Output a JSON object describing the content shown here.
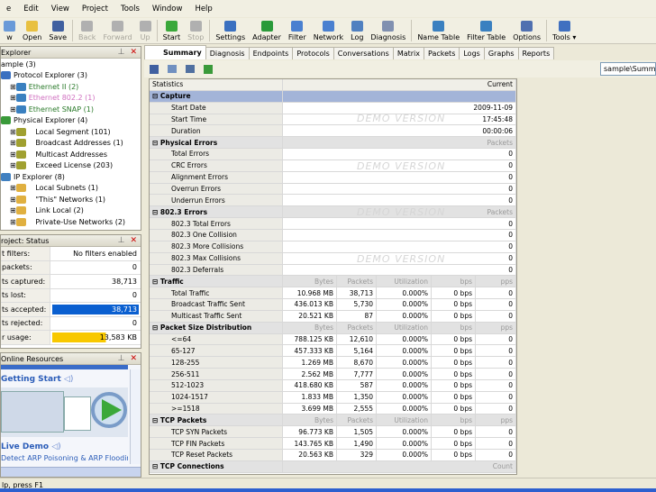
{
  "menu": [
    "e",
    "Edit",
    "View",
    "Project",
    "Tools",
    "Window",
    "Help"
  ],
  "toolbar": [
    {
      "label": "w",
      "color": "#6a9ad8"
    },
    {
      "label": "Open",
      "color": "#e8c040"
    },
    {
      "label": "Save",
      "color": "#4060a0"
    },
    {
      "sep": true
    },
    {
      "label": "Back",
      "color": "#b0b0b0",
      "disabled": true
    },
    {
      "label": "Forward",
      "color": "#b0b0b0",
      "disabled": true
    },
    {
      "label": "Up",
      "color": "#b0b0b0",
      "disabled": true
    },
    {
      "sep": true
    },
    {
      "label": "Start",
      "color": "#3aa83a"
    },
    {
      "label": "Stop",
      "color": "#b0b0b0",
      "disabled": true
    },
    {
      "sep": true
    },
    {
      "label": "Settings",
      "color": "#3a70c0"
    },
    {
      "label": "Adapter",
      "color": "#2a9a3a"
    },
    {
      "label": "Filter",
      "color": "#4a80d0"
    },
    {
      "label": "Network",
      "color": "#4a80d0"
    },
    {
      "label": "Log",
      "color": "#5080c0"
    },
    {
      "label": "Diagnosis",
      "color": "#8090b0"
    },
    {
      "sep": true
    },
    {
      "label": "Name Table",
      "color": "#3a80c0"
    },
    {
      "label": "Filter Table",
      "color": "#3a80c0"
    },
    {
      "label": "Options",
      "color": "#5070b0"
    },
    {
      "sep": true
    },
    {
      "label": "Tools ▾",
      "color": "#4070c0"
    }
  ],
  "explorer": {
    "title": "Explorer",
    "items": [
      {
        "label": "ample (3)",
        "indent": 0,
        "color": "#000",
        "icon": "none"
      },
      {
        "label": "Protocol Explorer (3)",
        "indent": 0,
        "color": "#000",
        "icon": "#3a70c0"
      },
      {
        "label": "Ethernet II (2)",
        "indent": 1,
        "color": "#2a7a2a",
        "icon": "#3a80c0"
      },
      {
        "label": "Ethernet 802.2 (1)",
        "indent": 1,
        "color": "#d070c0",
        "icon": "#3a80c0"
      },
      {
        "label": "Ethernet SNAP (1)",
        "indent": 1,
        "color": "#2a7a2a",
        "icon": "#3a80c0"
      },
      {
        "label": "Physical Explorer (4)",
        "indent": 0,
        "color": "#000",
        "icon": "#3a9a3a"
      },
      {
        "label": "Local Segment (101)",
        "indent": 2,
        "color": "#000",
        "icon": "#a0a030"
      },
      {
        "label": "Broadcast Addresses (1)",
        "indent": 2,
        "color": "#000",
        "icon": "#a0a030"
      },
      {
        "label": "Multicast Addresses",
        "indent": 2,
        "color": "#000",
        "icon": "#a0a030"
      },
      {
        "label": "Exceed License (203)",
        "indent": 2,
        "color": "#000",
        "icon": "#a0a030"
      },
      {
        "label": "IP Explorer (8)",
        "indent": 0,
        "color": "#000",
        "icon": "#4080c0"
      },
      {
        "label": "Local Subnets (1)",
        "indent": 2,
        "color": "#000",
        "icon": "#e0b040"
      },
      {
        "label": "\"This\" Networks (1)",
        "indent": 2,
        "color": "#000",
        "icon": "#e0b040"
      },
      {
        "label": "Link Local (2)",
        "indent": 2,
        "color": "#000",
        "icon": "#e0b040"
      },
      {
        "label": "Private-Use Networks (2)",
        "indent": 2,
        "color": "#000",
        "icon": "#e0b040"
      }
    ]
  },
  "status": {
    "title": "roject: Status",
    "rows": [
      {
        "label": "t filters:",
        "value": "No filters enabled"
      },
      {
        "label": "packets:",
        "value": "0"
      },
      {
        "label": "ts captured:",
        "value": "38,713"
      },
      {
        "label": "ts lost:",
        "value": "0"
      },
      {
        "label": "ts accepted:",
        "value": "38,713",
        "bar": "#0a5fd0",
        "fill": 1.0
      },
      {
        "label": "ts rejected:",
        "value": "0"
      },
      {
        "label": "r usage:",
        "value": "13,583 KB",
        "bar": "#f8c800",
        "fill": 0.62
      }
    ]
  },
  "online": {
    "title": "Online Resources",
    "getting_started": "Getting Start",
    "live_demo": "Live Demo",
    "link": "Detect ARP Poisoning & ARP Flooding"
  },
  "tabs": [
    "Summary",
    "Diagnosis",
    "Endpoints",
    "Protocols",
    "Conversations",
    "Matrix",
    "Packets",
    "Logs",
    "Graphs",
    "Reports"
  ],
  "path": "sample\\Summary",
  "watermark": "DEMO VERSION",
  "grid": {
    "headers": [
      "Statistics",
      "Current"
    ],
    "sections": [
      {
        "title": "Capture",
        "blue": true,
        "cols": [],
        "rows": [
          [
            "Start Date",
            "2009-11-09"
          ],
          [
            "Start Time",
            "17:45:48"
          ],
          [
            "Duration",
            "00:00:06"
          ]
        ]
      },
      {
        "title": "Physical Errors",
        "cols": [
          "Packets"
        ],
        "rows": [
          [
            "Total Errors",
            "0"
          ],
          [
            "CRC Errors",
            "0"
          ],
          [
            "Alignment Errors",
            "0"
          ],
          [
            "Overrun Errors",
            "0"
          ],
          [
            "Underrun Errors",
            "0"
          ]
        ]
      },
      {
        "title": "802.3 Errors",
        "cols": [
          "Packets"
        ],
        "rows": [
          [
            "802.3 Total Errors",
            "0"
          ],
          [
            "802.3 One Collision",
            "0"
          ],
          [
            "802.3 More Collisions",
            "0"
          ],
          [
            "802.3 Max Collisions",
            "0"
          ],
          [
            "802.3 Deferrals",
            "0"
          ]
        ]
      },
      {
        "title": "Traffic",
        "cols": [
          "Bytes",
          "Packets",
          "Utilization",
          "bps",
          "pps"
        ],
        "rows": [
          [
            "Total Traffic",
            "10.968 MB",
            "38,713",
            "0.000%",
            "0 bps",
            "0"
          ],
          [
            "Broadcast Traffic Sent",
            "436.013 KB",
            "5,730",
            "0.000%",
            "0 bps",
            "0"
          ],
          [
            "Multicast Traffic Sent",
            "20.521 KB",
            "87",
            "0.000%",
            "0 bps",
            "0"
          ]
        ]
      },
      {
        "title": "Packet Size Distribution",
        "cols": [
          "Bytes",
          "Packets",
          "Utilization",
          "bps",
          "pps"
        ],
        "rows": [
          [
            "<=64",
            "788.125 KB",
            "12,610",
            "0.000%",
            "0 bps",
            "0"
          ],
          [
            "65-127",
            "457.333 KB",
            "5,164",
            "0.000%",
            "0 bps",
            "0"
          ],
          [
            "128-255",
            "1.269 MB",
            "8,670",
            "0.000%",
            "0 bps",
            "0"
          ],
          [
            "256-511",
            "2.562 MB",
            "7,777",
            "0.000%",
            "0 bps",
            "0"
          ],
          [
            "512-1023",
            "418.680 KB",
            "587",
            "0.000%",
            "0 bps",
            "0"
          ],
          [
            "1024-1517",
            "1.833 MB",
            "1,350",
            "0.000%",
            "0 bps",
            "0"
          ],
          [
            ">=1518",
            "3.699 MB",
            "2,555",
            "0.000%",
            "0 bps",
            "0"
          ]
        ]
      },
      {
        "title": "TCP Packets",
        "cols": [
          "Bytes",
          "Packets",
          "Utilization",
          "bps",
          "pps"
        ],
        "rows": [
          [
            "TCP SYN Packets",
            "96.773 KB",
            "1,505",
            "0.000%",
            "0 bps",
            "0"
          ],
          [
            "TCP FIN Packets",
            "143.765 KB",
            "1,490",
            "0.000%",
            "0 bps",
            "0"
          ],
          [
            "TCP Reset Packets",
            "20.563 KB",
            "329",
            "0.000%",
            "0 bps",
            "0"
          ]
        ]
      },
      {
        "title": "TCP Connections",
        "cols": [
          "Count"
        ],
        "rows": []
      }
    ]
  },
  "statusbar": "lp, press F1"
}
